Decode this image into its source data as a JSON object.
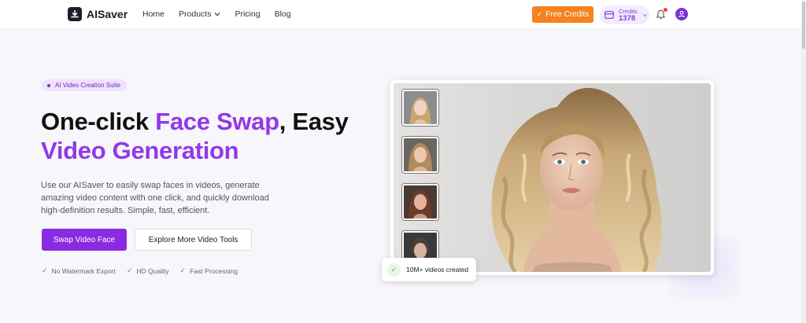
{
  "header": {
    "logo_text": "AISaver",
    "nav": [
      "Home",
      "Products",
      "Pricing",
      "Blog"
    ],
    "free_credits_label": "Free Credits",
    "credits_label": "Credits",
    "credits_value": "1378"
  },
  "hero": {
    "badge": "AI Video Creation Suite",
    "headline_part1": "One-click ",
    "headline_highlight1": "Face Swap",
    "headline_part2": ", Easy",
    "headline_highlight2": "Video Generation",
    "description": "Use our AISaver to easily swap faces in videos, generate amazing video content with one click, and quickly download high-definition results. Simple, fast, efficient.",
    "primary_button": "Swap Video Face",
    "secondary_button": "Explore More Video Tools",
    "features": [
      "No Watermark Export",
      "HD Quality",
      "Fast Processing"
    ]
  },
  "showcase": {
    "toast_text": "10M+ videos created"
  },
  "colors": {
    "accent_purple": "#9238e8",
    "button_purple": "#8a2be2",
    "free_credits_orange": "#f5821f",
    "check_green": "#31b34a"
  },
  "icons": [
    "logo-mark-icon",
    "chevron-down-icon",
    "check-icon",
    "coins-icon",
    "bell-icon",
    "user-icon"
  ]
}
